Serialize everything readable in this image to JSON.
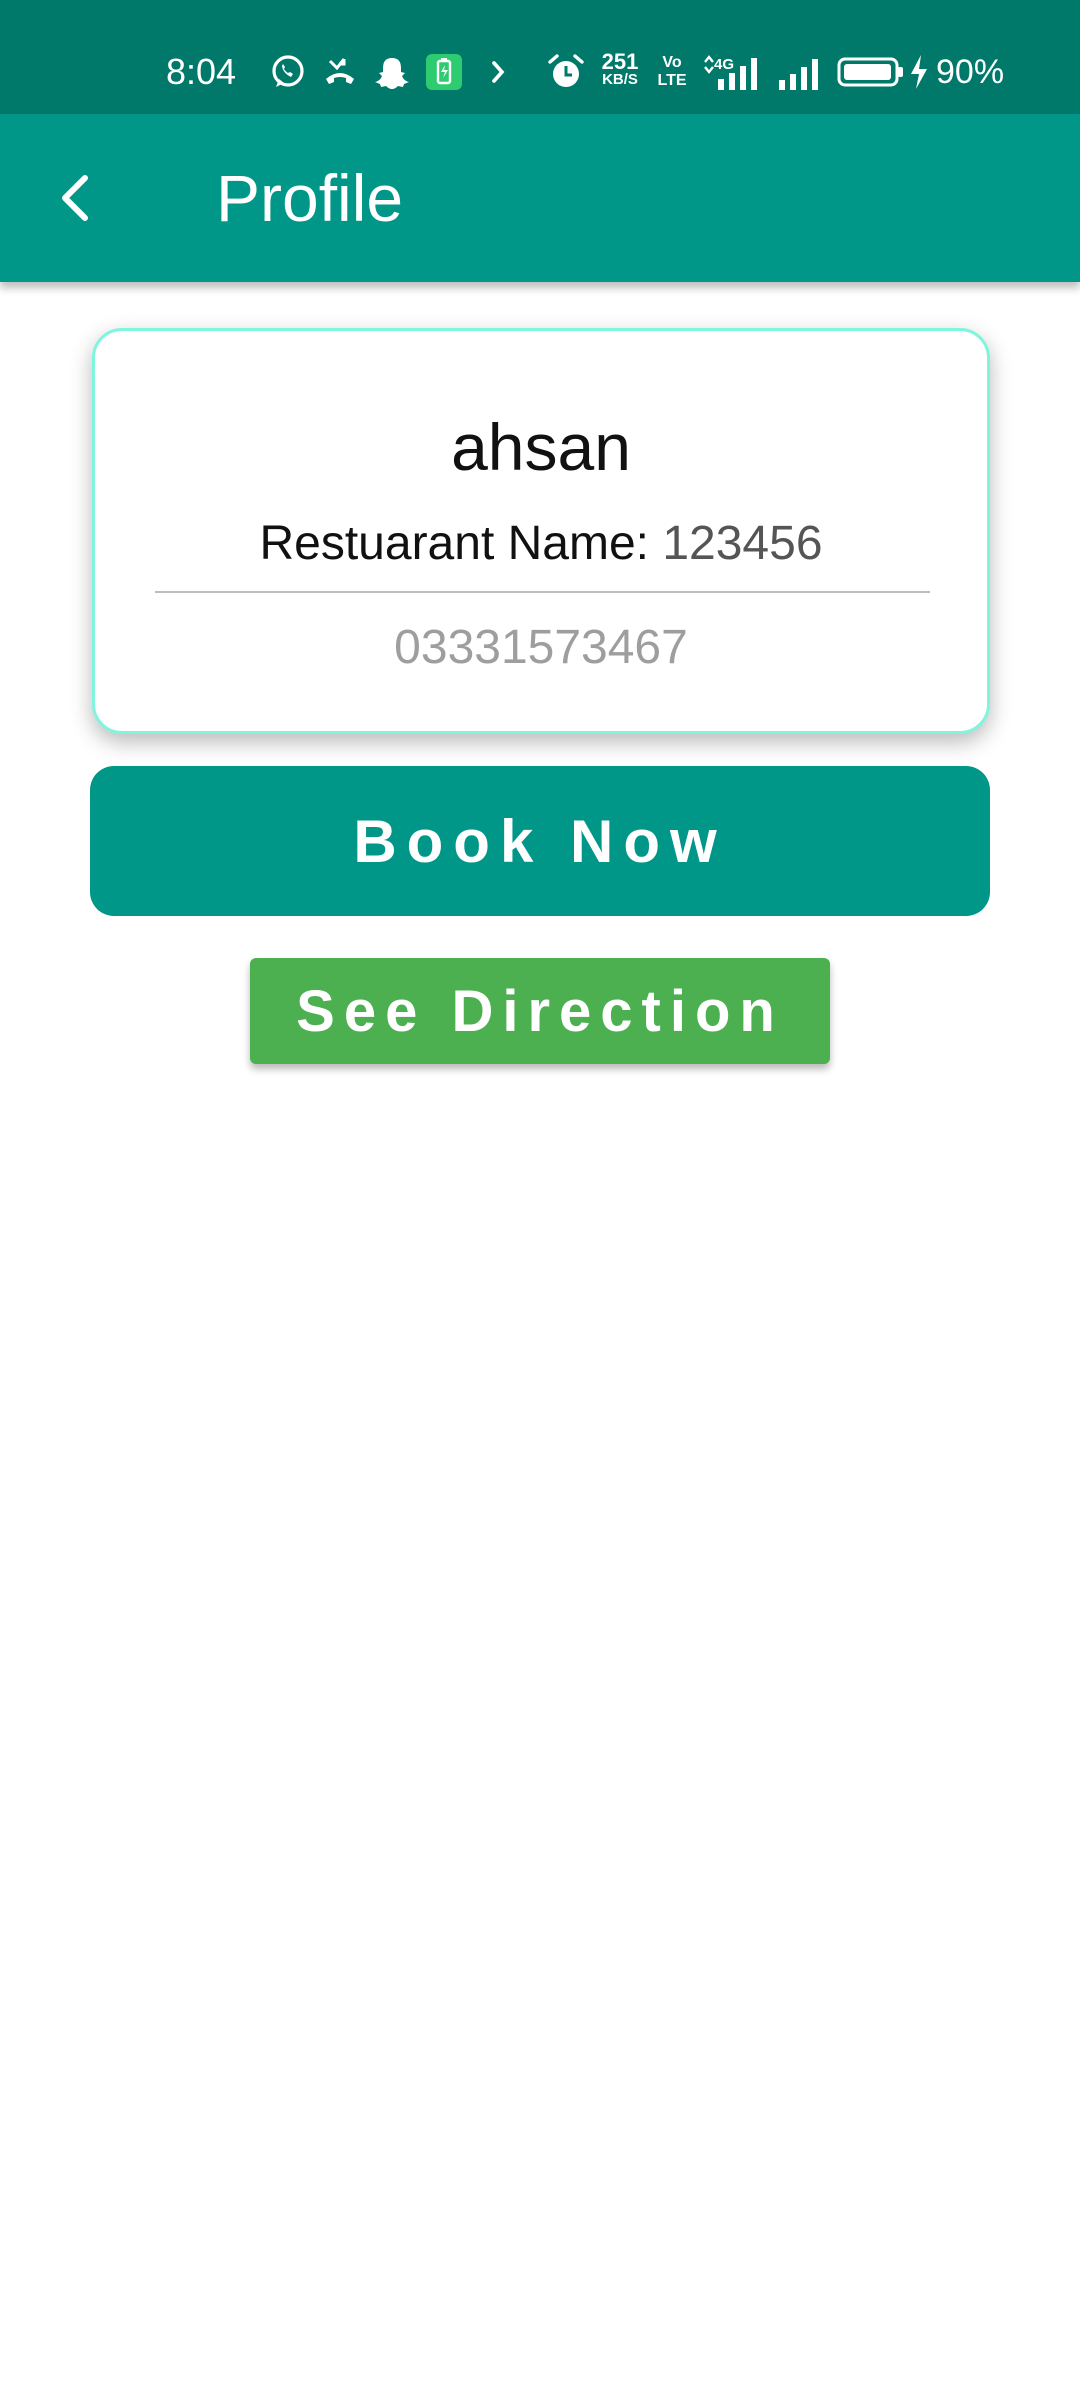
{
  "status_bar": {
    "time": "8:04",
    "net_speed_value": "251",
    "net_speed_unit": "KB/S",
    "volte_top": "Vo",
    "volte_bottom": "LTE",
    "network_type": "4G",
    "battery_percent": "90%",
    "notification_icons": [
      "whatsapp-icon",
      "missed-call-icon",
      "snapchat-icon",
      "battery-saver-icon",
      "more-notifications-icon"
    ],
    "system_icons": [
      "alarm-icon",
      "signal-4g-icon",
      "signal-icon",
      "battery-icon",
      "charging-icon"
    ]
  },
  "app_bar": {
    "title": "Profile",
    "back_icon": "back-arrow-icon"
  },
  "profile": {
    "name": "ahsan",
    "restaurant_label": "Restuarant Name:",
    "restaurant_value": "123456",
    "phone": "03331573467"
  },
  "actions": {
    "book_label": "Book Now",
    "direction_label": "See Direction"
  },
  "colors": {
    "status_bar": "#00796b",
    "app_bar": "#009688",
    "book_button": "#009688",
    "direction_button": "#4caf50",
    "card_border": "#7ff5de"
  }
}
